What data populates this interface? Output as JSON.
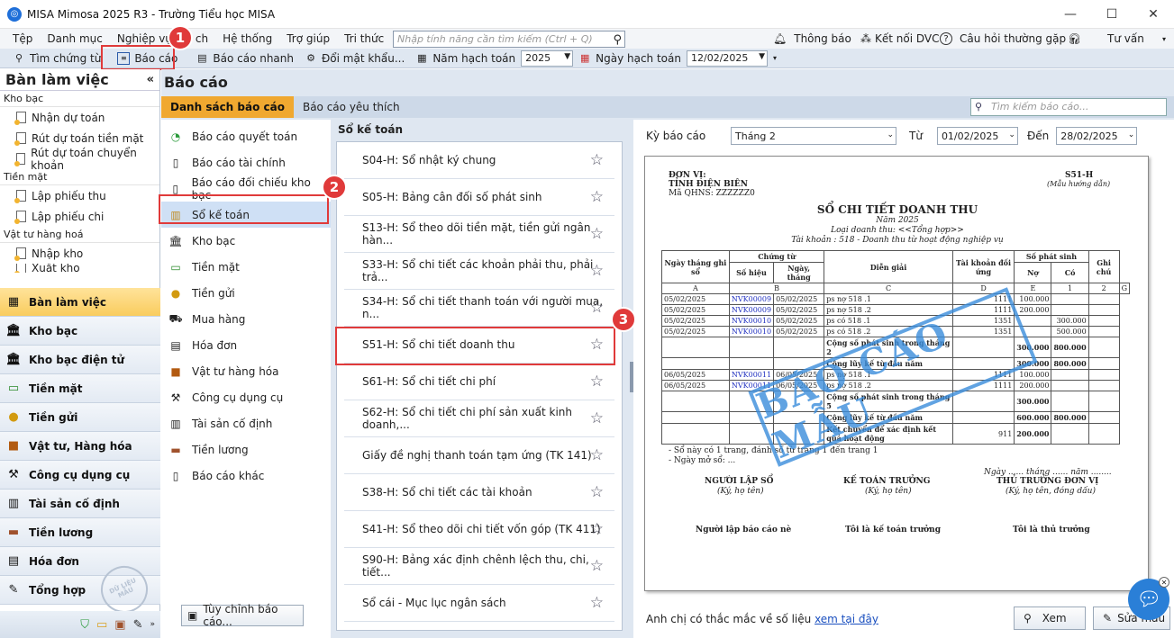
{
  "window": {
    "title": "MISA Mimosa 2025 R3 - Trường Tiểu học MISA"
  },
  "menu": {
    "items": [
      "Tệp",
      "Danh mục",
      "Nghiệp vụ",
      "ch",
      "Hệ thống",
      "Trợ giúp",
      "Tri thức"
    ],
    "search_placeholder": "Nhập tính năng cần tìm kiếm (Ctrl + Q)",
    "right": {
      "notify": "Thông báo",
      "connect": "Kết nối DVC",
      "faq": "Câu hỏi thường gặp",
      "consult": "Tư vấn"
    }
  },
  "toolbar": {
    "find": "Tìm chứng từ",
    "report": "Báo cáo",
    "quick_report": "Báo cáo nhanh",
    "change_pw": "Đổi mật khẩu...",
    "fiscal_year_label": "Năm hạch toán",
    "fiscal_year": "2025",
    "date_label": "Ngày hạch toán",
    "date": "12/02/2025"
  },
  "badges": [
    "1",
    "2",
    "3"
  ],
  "workspace": {
    "title": "Bàn làm việc",
    "sections": [
      {
        "name": "Kho bạc",
        "items": [
          "Nhận dự toán",
          "Rút dự toán tiền mặt",
          "Rút dự toán chuyển khoản"
        ]
      },
      {
        "name": "Tiền mặt",
        "items": [
          "Lập phiếu thu",
          "Lập phiếu chi"
        ]
      },
      {
        "name": "Vật tư hàng hoá",
        "items": [
          "Nhập kho",
          "Xuất kho"
        ]
      }
    ]
  },
  "nav": [
    "Bàn làm việc",
    "Kho bạc",
    "Kho bạc điện tử",
    "Tiền mặt",
    "Tiền gửi",
    "Vật tư, Hàng hóa",
    "Công cụ dụng cụ",
    "Tài sản cố định",
    "Tiền lương",
    "Hóa đơn",
    "Tổng hợp"
  ],
  "main": {
    "title": "Báo cáo",
    "tabs": [
      "Danh sách báo cáo",
      "Báo cáo yêu thích"
    ],
    "search_placeholder": "Tìm kiếm báo cáo...",
    "categories": [
      "Báo cáo quyết toán",
      "Báo cáo tài chính",
      "Báo cáo đối chiếu kho bạc",
      "Sổ kế toán",
      "Kho bạc",
      "Tiền mặt",
      "Tiền gửi",
      "Mua hàng",
      "Hóa đơn",
      "Vật tư hàng hóa",
      "Công cụ dụng cụ",
      "Tài sản cố định",
      "Tiền lương",
      "Báo cáo khác"
    ],
    "customize_button": "Tùy chỉnh báo cáo...",
    "report_group": "Sổ kế toán",
    "reports": [
      "S04-H: Sổ nhật ký chung",
      "S05-H: Bảng cân đối số phát sinh",
      "S13-H: Sổ theo dõi tiền mặt, tiền gửi ngân hàn...",
      "S33-H: Sổ chi tiết các khoản phải thu, phải trả...",
      "S34-H: Sổ chi tiết thanh toán với người mua, n...",
      "S51-H: Sổ chi tiết doanh thu",
      "S61-H: Sổ chi tiết chi phí",
      "S62-H: Sổ chi tiết chi phí sản xuất kinh doanh,...",
      "Giấy đề nghị thanh toán tạm ứng (TK 141)",
      "S38-H: Sổ chi tiết các tài khoản",
      "S41-H: Sổ theo dõi chi tiết vốn góp (TK 411)",
      "S90-H: Bảng xác định chênh lệch thu, chi, tiết...",
      "Sổ cái - Mục lục ngân sách"
    ]
  },
  "preview": {
    "period_label": "Kỳ báo cáo",
    "period": "Tháng 2",
    "from_label": "Từ",
    "from": "01/02/2025",
    "to_label": "Đến",
    "to": "28/02/2025",
    "footer_text": "Anh chị có thắc mắc về số liệu",
    "footer_link": "xem tại đây",
    "view_button": "Xem",
    "edit_button": "Sửa mẫu",
    "paper": {
      "unit_label": "ĐƠN VỊ:",
      "unit": "TỈNH ĐIỆN BIÊN",
      "qhns": "Mã QHNS: ZZZZZZ0",
      "code": "S51-H",
      "code_note": "(Mẫu hướng dẫn)",
      "title": "SỔ CHI TIẾT DOANH THU",
      "year": "Năm 2025",
      "revenue_type": "Loại doanh thu: <<Tổng hợp>>",
      "account": "Tài khoản : 518 - Doanh thu từ hoạt động nghiệp vụ",
      "headers": [
        "Ngày tháng ghi sổ",
        "Chứng từ",
        "Số hiệu",
        "Ngày, tháng",
        "Diễn giải",
        "Tài khoản đối ứng",
        "Số phát sinh",
        "Nợ",
        "Có",
        "Ghi chú"
      ],
      "col_codes": [
        "A",
        "B",
        "C",
        "D",
        "E",
        "1",
        "2",
        "G"
      ],
      "rows": [
        [
          "05/02/2025",
          "NVK00009",
          "05/02/2025",
          "ps nợ 518 .1",
          "1111",
          "100.000",
          ""
        ],
        [
          "05/02/2025",
          "NVK00009",
          "05/02/2025",
          "ps nợ 518 .2",
          "1111",
          "200.000",
          ""
        ],
        [
          "05/02/2025",
          "NVK00010",
          "05/02/2025",
          "ps có 518 .1",
          "1351",
          "",
          "300.000"
        ],
        [
          "05/02/2025",
          "NVK00010",
          "05/02/2025",
          "ps có 518 .2",
          "1351",
          "",
          "500.000"
        ],
        [
          "",
          "",
          "",
          "Cộng số phát sinh trong tháng 2",
          "",
          "300.000",
          "800.000"
        ],
        [
          "",
          "",
          "",
          "Cộng lũy kế từ đầu năm",
          "",
          "300.000",
          "800.000"
        ],
        [
          "06/05/2025",
          "NVK00011",
          "06/05/2025",
          "ps nợ 518 .1",
          "1111",
          "100.000",
          ""
        ],
        [
          "06/05/2025",
          "NVK00011",
          "06/05/2025",
          "ps nợ 518 .2",
          "1111",
          "200.000",
          ""
        ],
        [
          "",
          "",
          "",
          "Cộng số phát sinh trong tháng 5",
          "",
          "300.000",
          ""
        ],
        [
          "",
          "",
          "",
          "Cộng lũy kế từ đầu năm",
          "",
          "600.000",
          "800.000"
        ],
        [
          "",
          "",
          "",
          "Kết chuyển để xác định kết quả hoạt động",
          "911",
          "200.000",
          ""
        ]
      ],
      "note1": "- Sổ này có 1 trang, đánh số từ trang 1 đến trang 1",
      "note2": "- Ngày mở sổ: ...",
      "date_line": "Ngày ...... tháng ...... năm ........",
      "signers": [
        "NGƯỜI LẬP SỔ",
        "KẾ TOÁN TRƯỞNG",
        "THỦ TRƯỞNG ĐƠN VỊ"
      ],
      "signer_notes": [
        "(Ký, họ tên)",
        "(Ký, họ tên)",
        "(Ký, họ tên, đóng dấu)"
      ],
      "signer_names": [
        "Người lập báo cáo nè",
        "Tôi là kế toán trưởng",
        "Tôi là thủ trưởng"
      ],
      "stamp": "BÁO CÁO MẪU"
    }
  },
  "watermark": "DỮ LIỆU MẪU"
}
